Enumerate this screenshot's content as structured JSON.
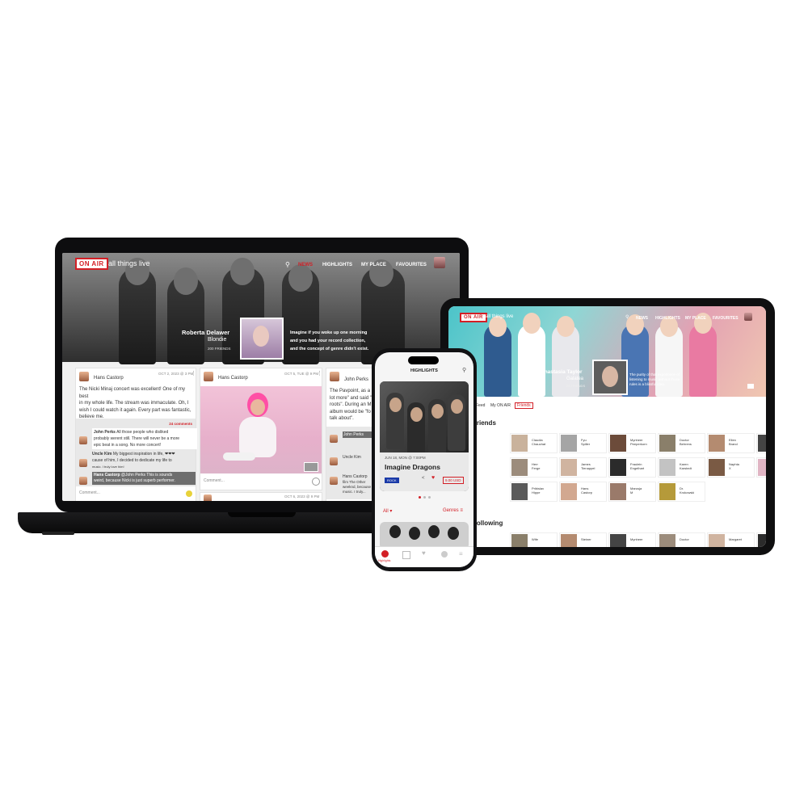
{
  "brand": {
    "logo": "ON AIR",
    "tagline": "all things live",
    "accent": "#d31f26"
  },
  "laptop": {
    "nav": [
      "NEWS",
      "HIGHLIGHTS",
      "MY PLACE",
      "FAVOURITES"
    ],
    "hero": {
      "artist": "Roberta Delawer",
      "role": "Blondie",
      "followers": "200 FRIENDS",
      "quote_lines": [
        "Imagine if you woke up one morning",
        "and you had your record collection,",
        "and the concept of genre didn't exist."
      ]
    },
    "posts": [
      {
        "author": "Hans Castorp",
        "date": "OCT 2, 2023 @ 3 PM",
        "text_lines": [
          "The Nicki Minaj concert was excellent! One of my best",
          "in my whole life. The stream was immaculate. Oh, I",
          "wish I could watch it again. Every part was fantastic,",
          "believe me."
        ],
        "comments_count": "24 comments",
        "comments": [
          {
            "author": "John Perks",
            "text_lines": [
              "All those people who disliked",
              "probably werent still. There will never be a more",
              "epic beat in a song. No more concert!"
            ]
          },
          {
            "author": "Uncle Kim",
            "text_lines": [
              "My biggest inspiration in life, ❤❤❤",
              "cause of him, I decided to dedicate my life to",
              "music. I truly love him!"
            ]
          },
          {
            "author": "Hans Castorp",
            "text_lines": [
              "@John Perks This is sounds",
              "weird, because Nicki is just superb performer."
            ]
          }
        ],
        "comment_placeholder": "Comment..."
      },
      {
        "author": "Hans Castorp",
        "date": "OCT 5, TUE @ 9 PM",
        "comment_placeholder": "Comment..."
      },
      {
        "author": "John Perks",
        "date": "OCT 6, FRI @ 9 PM",
        "text_lines": [
          "The Pavpoint, as a",
          "lot more\" and said \"I",
          "roots\". During an M",
          "album would be \"fo",
          "talk about\"."
        ],
        "comments": [
          {
            "author": "John Perks"
          },
          {
            "author": "Uncle Kim"
          },
          {
            "author": "Hans Castorp"
          }
        ],
        "side_lines": [
          "film The Other",
          "weeknd, because",
          "music. I truly..."
        ]
      }
    ],
    "footer_date": "OCT 6, 2023 @ 9 PM"
  },
  "tablet": {
    "nav": [
      "NEWS",
      "HIGHLIGHTS",
      "MY PLACE",
      "FAVOURITES"
    ],
    "hero": {
      "artist": "Anastasia Taylor",
      "role": "Galatea",
      "followers": "24 FRIENDS",
      "quote_lines": [
        "The purity of that experience of",
        "listening to music without those",
        "rules is a blissful idea."
      ]
    },
    "tabs": [
      "Feed",
      "My ON AIR",
      "Friends"
    ],
    "active_tab": "Friends",
    "section_friends": "Friends",
    "section_following": "Following",
    "friends": [
      [
        "Claudia",
        "Chauchat"
      ],
      [
        "Fyu",
        "Spiller"
      ],
      [
        "Mynheer",
        "Peeperkorn"
      ],
      [
        "Doctor",
        "Behrens"
      ],
      [
        "Ellen",
        "Brand"
      ],
      [
        "Herr",
        "Albin"
      ],
      [
        "Herr",
        "Ferge"
      ],
      [
        "James",
        "Tienappel"
      ],
      [
        "Fraulein",
        "Engelhart"
      ],
      [
        "Karen",
        "Karstedt"
      ],
      [
        "Naphta",
        "X"
      ],
      [
        "Hermine",
        "Kleefeld"
      ],
      [
        "Pribislav",
        "Hippe"
      ],
      [
        "Hans",
        "Castorp"
      ],
      [
        "Marusja",
        "M"
      ],
      [
        "Dr.",
        "Krokowski"
      ]
    ],
    "following": [
      "Wife",
      "Steiner",
      "Mynheer",
      "Doctor",
      "Margaret",
      "Henrik"
    ]
  },
  "phone": {
    "title": "HIGHLIGHTS",
    "event": {
      "date": "JUN 18, MON @ 7:00PM",
      "artist": "Imagine Dragons",
      "genre": "ROCK",
      "price": "9.00 USD"
    },
    "filter_left": "All",
    "filter_right": "Genres",
    "tabbar": [
      "Highlights",
      "News",
      "Favourites",
      "Profile",
      "More"
    ]
  }
}
